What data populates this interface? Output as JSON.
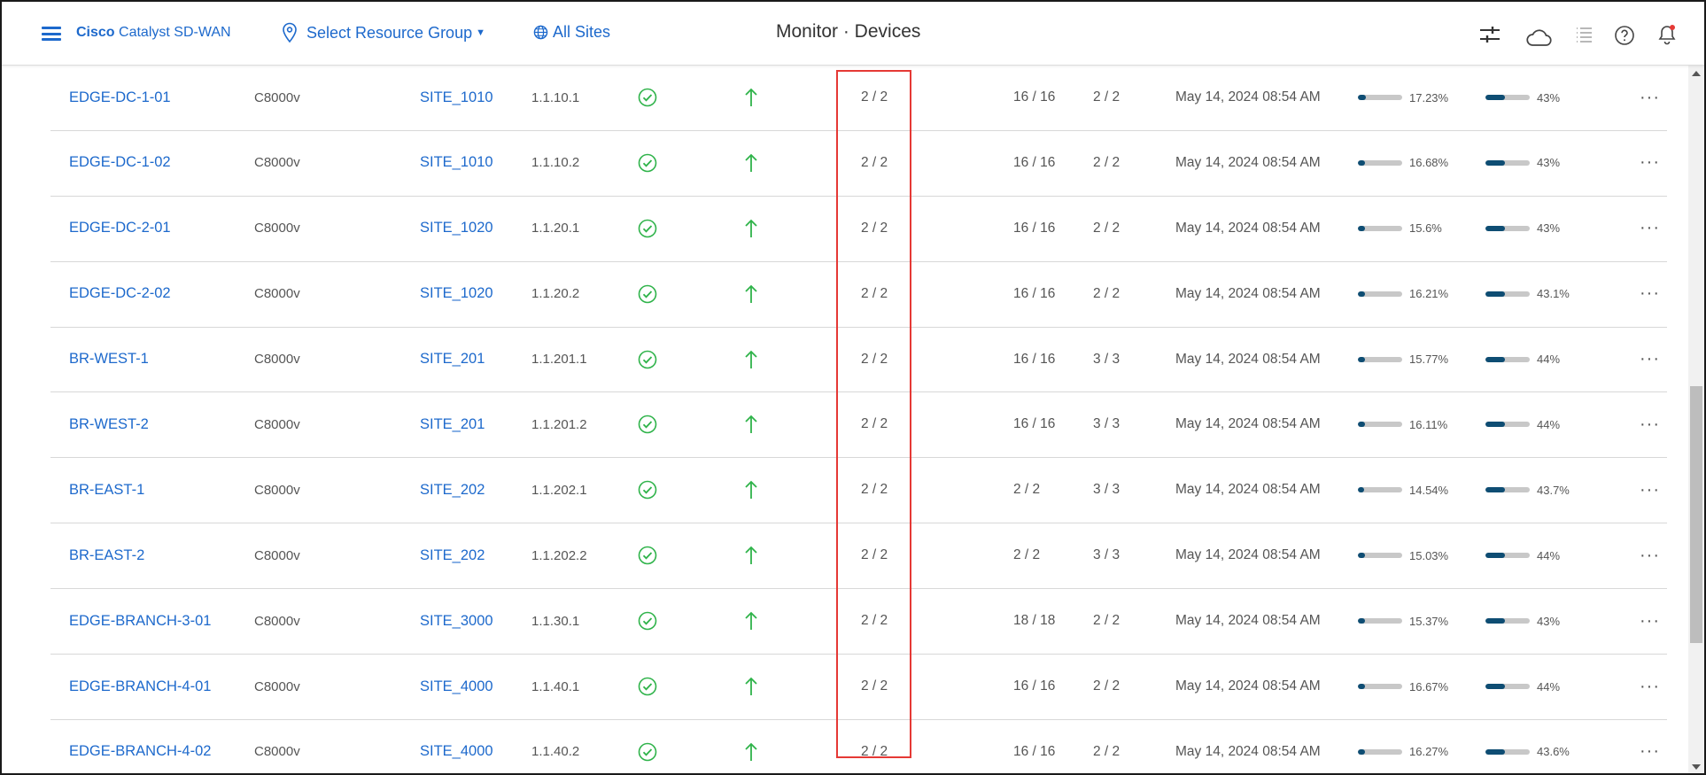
{
  "header": {
    "brand_bold": "Cisco",
    "brand_rest": "Catalyst SD-WAN",
    "resource_group": "Select Resource Group",
    "sites": "All Sites",
    "page_title": "Monitor · Devices"
  },
  "colors": {
    "accent": "#1d69cc",
    "healthy": "#2fb34a",
    "reachable": "#2fb34a",
    "bar_fill": "#0e4d73",
    "bar_track": "#c8c8c8",
    "highlight": "#e53935",
    "notification_dot": "#e53935"
  },
  "icons": {
    "menu": "hamburger-menu-icon",
    "location": "location-pin-icon",
    "globe": "globe-icon",
    "filters": "sliders-icon",
    "cloud": "cloud-icon",
    "tasks": "task-list-icon",
    "help": "help-icon",
    "notifications": "bell-icon",
    "health": "check-circle-icon",
    "reachability": "arrow-up-icon",
    "actions": "more-horizontal-icon"
  },
  "devices": [
    {
      "name": "EDGE-DC-1-01",
      "model": "C8000v",
      "site": "SITE_1010",
      "ip": "1.1.10.1",
      "control": "2 / 2",
      "bfd": "16 / 16",
      "omp": "2 / 2",
      "last_updated": "May 14, 2024 08:54 AM",
      "cpu": "17.23%",
      "cpu_pct": 17.23,
      "mem": "43%",
      "mem_pct": 43,
      "more": "···"
    },
    {
      "name": "EDGE-DC-1-02",
      "model": "C8000v",
      "site": "SITE_1010",
      "ip": "1.1.10.2",
      "control": "2 / 2",
      "bfd": "16 / 16",
      "omp": "2 / 2",
      "last_updated": "May 14, 2024 08:54 AM",
      "cpu": "16.68%",
      "cpu_pct": 16.68,
      "mem": "43%",
      "mem_pct": 43,
      "more": "···"
    },
    {
      "name": "EDGE-DC-2-01",
      "model": "C8000v",
      "site": "SITE_1020",
      "ip": "1.1.20.1",
      "control": "2 / 2",
      "bfd": "16 / 16",
      "omp": "2 / 2",
      "last_updated": "May 14, 2024 08:54 AM",
      "cpu": "15.6%",
      "cpu_pct": 15.6,
      "mem": "43%",
      "mem_pct": 43,
      "more": "···"
    },
    {
      "name": "EDGE-DC-2-02",
      "model": "C8000v",
      "site": "SITE_1020",
      "ip": "1.1.20.2",
      "control": "2 / 2",
      "bfd": "16 / 16",
      "omp": "2 / 2",
      "last_updated": "May 14, 2024 08:54 AM",
      "cpu": "16.21%",
      "cpu_pct": 16.21,
      "mem": "43.1%",
      "mem_pct": 43.1,
      "more": "···"
    },
    {
      "name": "BR-WEST-1",
      "model": "C8000v",
      "site": "SITE_201",
      "ip": "1.1.201.1",
      "control": "2 / 2",
      "bfd": "16 / 16",
      "omp": "3 / 3",
      "last_updated": "May 14, 2024 08:54 AM",
      "cpu": "15.77%",
      "cpu_pct": 15.77,
      "mem": "44%",
      "mem_pct": 44,
      "more": "···"
    },
    {
      "name": "BR-WEST-2",
      "model": "C8000v",
      "site": "SITE_201",
      "ip": "1.1.201.2",
      "control": "2 / 2",
      "bfd": "16 / 16",
      "omp": "3 / 3",
      "last_updated": "May 14, 2024 08:54 AM",
      "cpu": "16.11%",
      "cpu_pct": 16.11,
      "mem": "44%",
      "mem_pct": 44,
      "more": "···"
    },
    {
      "name": "BR-EAST-1",
      "model": "C8000v",
      "site": "SITE_202",
      "ip": "1.1.202.1",
      "control": "2 / 2",
      "bfd": "2 / 2",
      "omp": "3 / 3",
      "last_updated": "May 14, 2024 08:54 AM",
      "cpu": "14.54%",
      "cpu_pct": 14.54,
      "mem": "43.7%",
      "mem_pct": 43.7,
      "more": "···"
    },
    {
      "name": "BR-EAST-2",
      "model": "C8000v",
      "site": "SITE_202",
      "ip": "1.1.202.2",
      "control": "2 / 2",
      "bfd": "2 / 2",
      "omp": "3 / 3",
      "last_updated": "May 14, 2024 08:54 AM",
      "cpu": "15.03%",
      "cpu_pct": 15.03,
      "mem": "44%",
      "mem_pct": 44,
      "more": "···"
    },
    {
      "name": "EDGE-BRANCH-3-01",
      "model": "C8000v",
      "site": "SITE_3000",
      "ip": "1.1.30.1",
      "control": "2 / 2",
      "bfd": "18 / 18",
      "omp": "2 / 2",
      "last_updated": "May 14, 2024 08:54 AM",
      "cpu": "15.37%",
      "cpu_pct": 15.37,
      "mem": "43%",
      "mem_pct": 43,
      "more": "···"
    },
    {
      "name": "EDGE-BRANCH-4-01",
      "model": "C8000v",
      "site": "SITE_4000",
      "ip": "1.1.40.1",
      "control": "2 / 2",
      "bfd": "16 / 16",
      "omp": "2 / 2",
      "last_updated": "May 14, 2024 08:54 AM",
      "cpu": "16.67%",
      "cpu_pct": 16.67,
      "mem": "44%",
      "mem_pct": 44,
      "more": "···"
    },
    {
      "name": "EDGE-BRANCH-4-02",
      "model": "C8000v",
      "site": "SITE_4000",
      "ip": "1.1.40.2",
      "control": "2 / 2",
      "bfd": "16 / 16",
      "omp": "2 / 2",
      "last_updated": "May 14, 2024 08:54 AM",
      "cpu": "16.27%",
      "cpu_pct": 16.27,
      "mem": "43.6%",
      "mem_pct": 43.6,
      "more": "···"
    }
  ]
}
